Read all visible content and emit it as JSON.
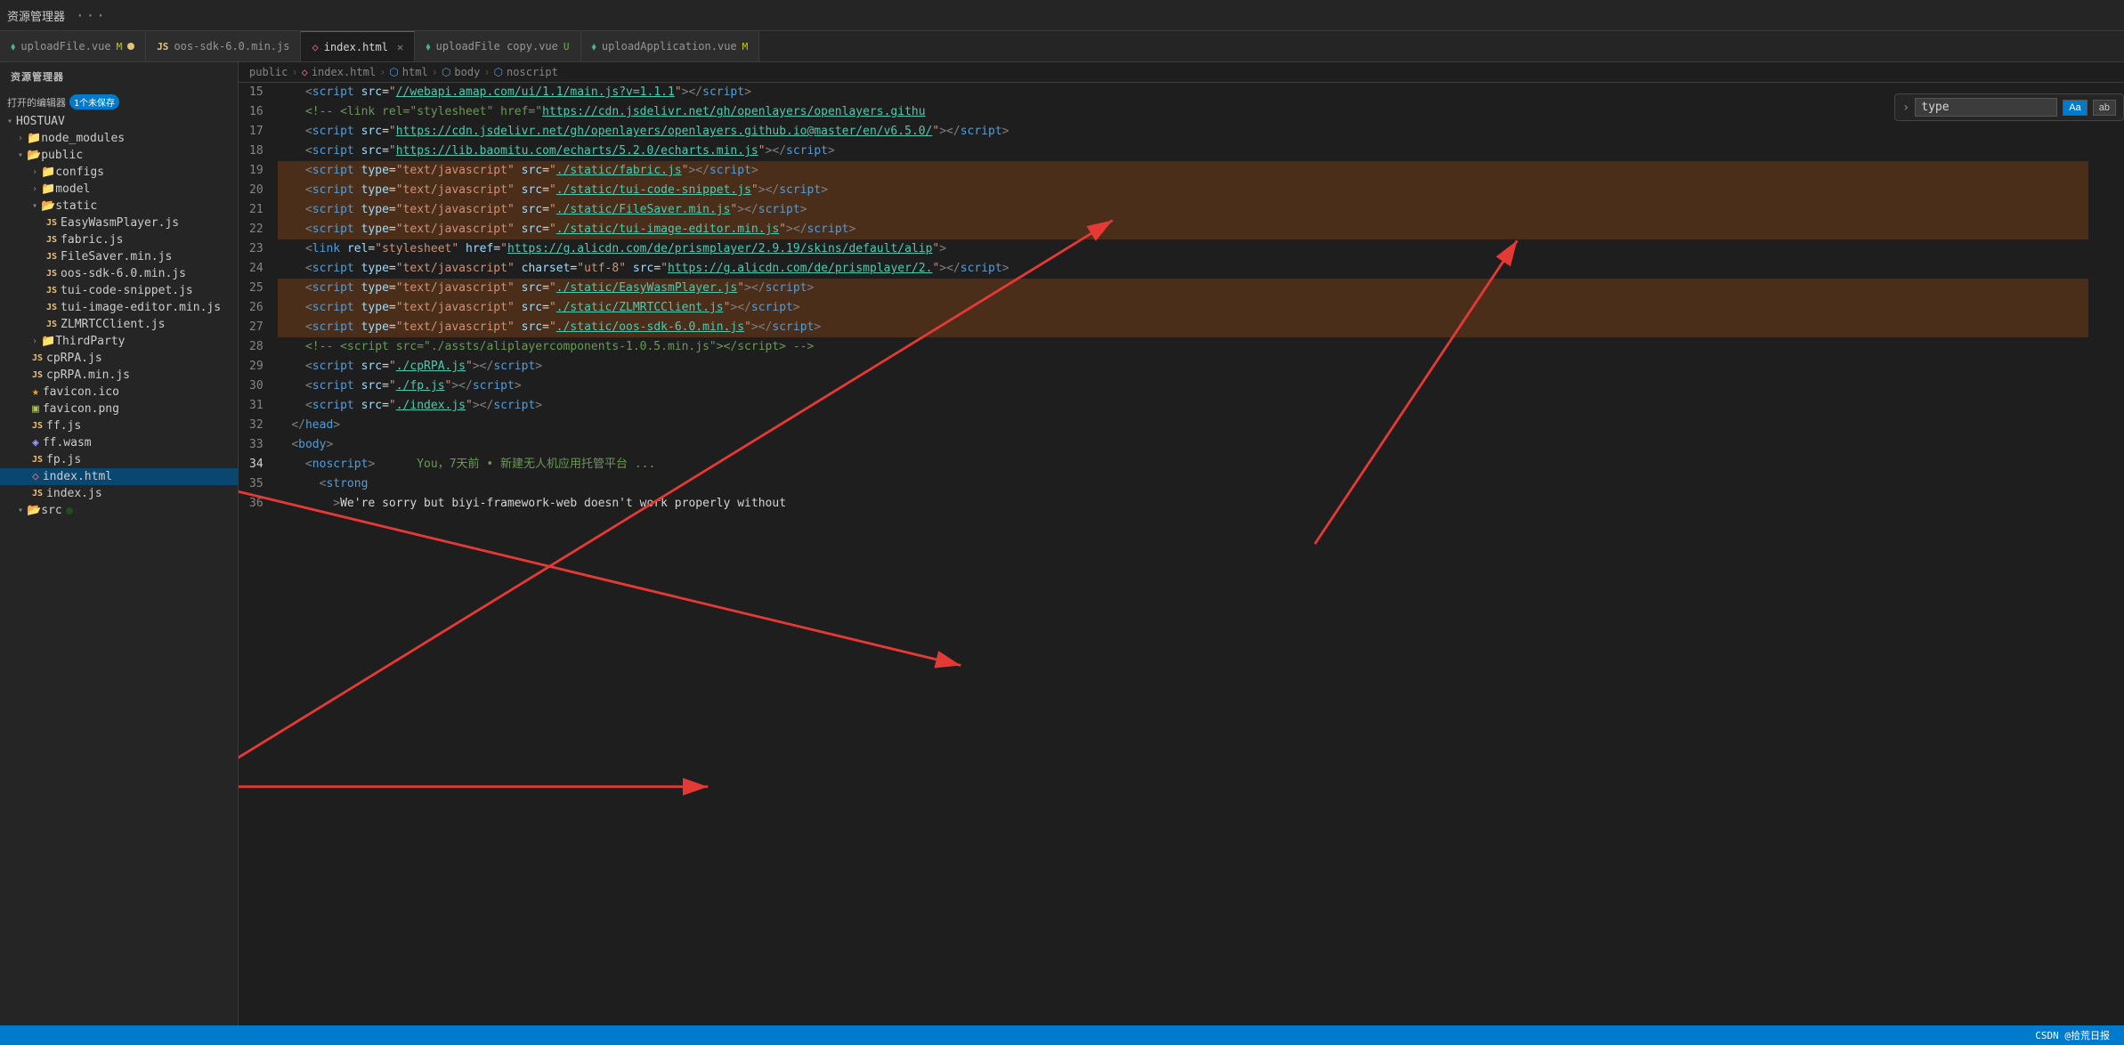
{
  "titlebar": {
    "title": "资源管理器",
    "dots": "···"
  },
  "tabs": [
    {
      "id": "uploadFile",
      "icon": "vue",
      "label": "uploadFile.vue",
      "badge": "M",
      "dot": true,
      "active": false
    },
    {
      "id": "oos-sdk",
      "icon": "js",
      "label": "oos-sdk-6.0.min.js",
      "active": false
    },
    {
      "id": "index",
      "icon": "html",
      "label": "index.html",
      "active": true,
      "closable": true
    },
    {
      "id": "uploadFile-copy",
      "icon": "vue",
      "label": "uploadFile copy.vue",
      "badge": "U",
      "active": false
    },
    {
      "id": "uploadApplication",
      "icon": "vue",
      "label": "uploadApplication.vue",
      "badge": "M",
      "active": false
    }
  ],
  "sidebar": {
    "open_editors_label": "打开的编辑器",
    "unsaved_badge": "1个未保存",
    "root": "HOSTUAV",
    "items": [
      {
        "type": "folder",
        "name": "node_modules",
        "indent": 1,
        "open": false
      },
      {
        "type": "folder",
        "name": "public",
        "indent": 1,
        "open": true,
        "arrow": "open"
      },
      {
        "type": "folder",
        "name": "configs",
        "indent": 2,
        "open": false
      },
      {
        "type": "folder",
        "name": "model",
        "indent": 2,
        "open": false
      },
      {
        "type": "folder",
        "name": "static",
        "indent": 2,
        "open": true,
        "arrow": "open"
      },
      {
        "type": "js",
        "name": "EasyWasmPlayer.js",
        "indent": 3
      },
      {
        "type": "js",
        "name": "fabric.js",
        "indent": 3
      },
      {
        "type": "js",
        "name": "FileSaver.min.js",
        "indent": 3
      },
      {
        "type": "js",
        "name": "oos-sdk-6.0.min.js",
        "indent": 3
      },
      {
        "type": "js",
        "name": "tui-code-snippet.js",
        "indent": 3
      },
      {
        "type": "js",
        "name": "tui-image-editor.min.js",
        "indent": 3
      },
      {
        "type": "js",
        "name": "ZLMRTCClient.js",
        "indent": 3
      },
      {
        "type": "folder",
        "name": "ThirdParty",
        "indent": 2,
        "open": false
      },
      {
        "type": "js",
        "name": "cpRPA.js",
        "indent": 2
      },
      {
        "type": "js",
        "name": "cpRPA.min.js",
        "indent": 2
      },
      {
        "type": "ico",
        "name": "favicon.ico",
        "indent": 2
      },
      {
        "type": "png",
        "name": "favicon.png",
        "indent": 2
      },
      {
        "type": "js",
        "name": "ff.js",
        "indent": 2
      },
      {
        "type": "wasm",
        "name": "ff.wasm",
        "indent": 2
      },
      {
        "type": "js",
        "name": "fp.js",
        "indent": 2
      },
      {
        "type": "html",
        "name": "index.html",
        "indent": 2,
        "selected": true
      },
      {
        "type": "js",
        "name": "index.js",
        "indent": 2
      },
      {
        "type": "folder",
        "name": "src",
        "indent": 1,
        "open": true
      }
    ]
  },
  "breadcrumb": {
    "items": [
      "public",
      "index.html",
      "html",
      "body",
      "noscript"
    ]
  },
  "find_bar": {
    "arrow": "›",
    "placeholder": "type",
    "value": "type",
    "btn_aa": "Aa",
    "btn_ab": "ab"
  },
  "code": {
    "lines": [
      {
        "num": 15,
        "content": "    <script src=\"//webapi.amap.com/ui/1.1/main.js?v=1.1.1\"></script>"
      },
      {
        "num": 16,
        "content": "    <!-- <link rel=\"stylesheet\" href=\"https://cdn.jsdelivr.net/gh/openlayers/openlayers.githu"
      },
      {
        "num": 17,
        "content": "    <script src=\"https://cdn.jsdelivr.net/gh/openlayers/openlayers.github.io@master/en/v6.5.0/"
      },
      {
        "num": 18,
        "content": "    <script src=\"https://lib.baomitu.com/echarts/5.2.0/echarts.min.js\"></script>"
      },
      {
        "num": 19,
        "content": "    <script type=\"text/javascript\" src=\"./static/fabric.js\"></script>",
        "highlight": true
      },
      {
        "num": 20,
        "content": "    <script type=\"text/javascript\" src=\"./static/tui-code-snippet.js\"></script>",
        "highlight": true
      },
      {
        "num": 21,
        "content": "    <script type=\"text/javascript\" src=\"./static/FileSaver.min.js\"></script>",
        "highlight": true
      },
      {
        "num": 22,
        "content": "    <script type=\"text/javascript\" src=\"./static/tui-image-editor.min.js\"></script>",
        "highlight": true
      },
      {
        "num": 23,
        "content": "    <link rel=\"stylesheet\" href=\"https://g.alicdn.com/de/prismplayer/2.9.19/skins/default/alip"
      },
      {
        "num": 24,
        "content": "    <script type=\"text/javascript\" charset=\"utf-8\" src=\"https://g.alicdn.com/de/prismplayer/2."
      },
      {
        "num": 25,
        "content": "    <script type=\"text/javascript\" src=\"./static/EasyWasmPlayer.js\"></script>",
        "highlight": true
      },
      {
        "num": 26,
        "content": "    <script type=\"text/javascript\" src=\"./static/ZLMRTCClient.js\"></script>",
        "highlight": true
      },
      {
        "num": 27,
        "content": "    <script type=\"text/javascript\" src=\"./static/oos-sdk-6.0.min.js\"></script>",
        "highlight": true
      },
      {
        "num": 28,
        "content": "    <!-- <script src=\"./assts/aliplayercomponents-1.0.5.min.js\"></script> -->"
      },
      {
        "num": 29,
        "content": "    <script src=\"./cpRPA.js\"></script>"
      },
      {
        "num": 30,
        "content": "    <script src=\"./fp.js\"></script>"
      },
      {
        "num": 31,
        "content": "    <script src=\"./index.js\"></script>"
      },
      {
        "num": 32,
        "content": "  </head>"
      },
      {
        "num": 33,
        "content": "  <body>"
      },
      {
        "num": 34,
        "content": "    <noscript>      You，7天前 • 新建无人机应用托管平台 ..."
      },
      {
        "num": 35,
        "content": "      <strong>"
      },
      {
        "num": 36,
        "content": "        >We're sorry but biyi-framework-web doesn't work properly without"
      }
    ]
  },
  "status_bar": {
    "text": "CSDN @拾荒日报"
  }
}
